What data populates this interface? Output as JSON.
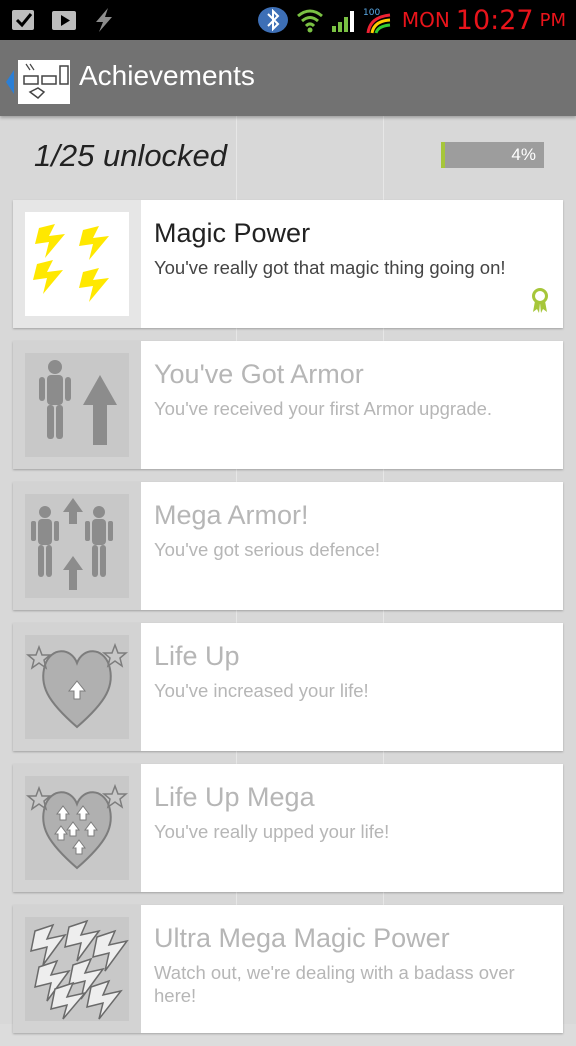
{
  "status_bar": {
    "day": "MON",
    "time": "10:27",
    "ampm": "PM",
    "icons": [
      "checkbox-icon",
      "play-store-icon",
      "flash-icon",
      "bluetooth-icon",
      "wifi-icon",
      "signal-icon",
      "data-icon"
    ]
  },
  "action_bar": {
    "title": "Achievements"
  },
  "summary": {
    "unlocked_text": "1/25 unlocked",
    "progress_label": "4%",
    "progress_fraction": 0.04
  },
  "colors": {
    "accent": "#a6c63a",
    "action_bar": "#727272",
    "time_red": "#e8141b"
  },
  "achievements": [
    {
      "name": "Magic Power",
      "description": "You've really got that magic thing going on!",
      "unlocked": true,
      "icon": "lightning-icon"
    },
    {
      "name": "You've Got Armor",
      "description": "You've received your first Armor upgrade.",
      "unlocked": false,
      "icon": "armor-up-icon"
    },
    {
      "name": "Mega Armor!",
      "description": "You've got serious defence!",
      "unlocked": false,
      "icon": "mega-armor-icon"
    },
    {
      "name": "Life Up",
      "description": "You've increased your life!",
      "unlocked": false,
      "icon": "heart-up-icon"
    },
    {
      "name": "Life Up Mega",
      "description": "You've really upped your life!",
      "unlocked": false,
      "icon": "heart-mega-icon"
    },
    {
      "name": "Ultra Mega Magic Power",
      "description": "Watch out, we're dealing with a badass over here!",
      "unlocked": false,
      "icon": "ultra-lightning-icon"
    }
  ]
}
